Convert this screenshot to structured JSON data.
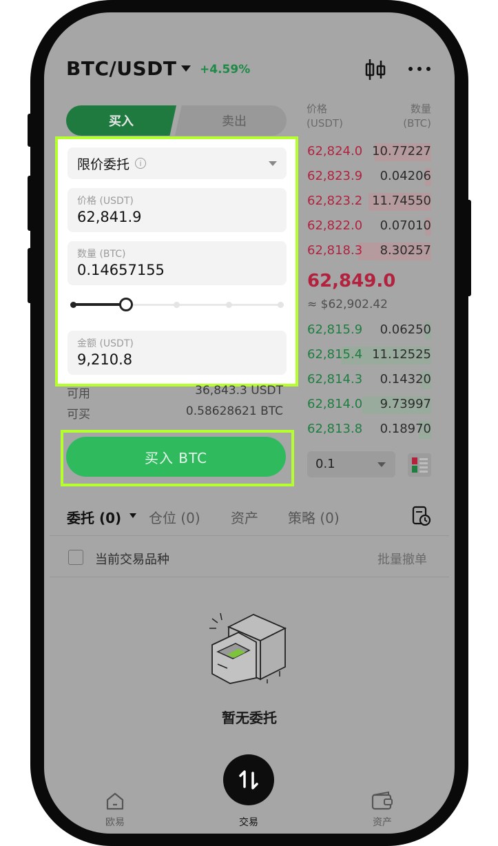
{
  "header": {
    "pair": "BTC/USDT",
    "change": "+4.59%"
  },
  "trade_tabs": {
    "buy": "买入",
    "sell": "卖出"
  },
  "form": {
    "order_type": "限价委托",
    "price_label": "价格 (USDT)",
    "price_value": "62,841.9",
    "qty_label": "数量 (BTC)",
    "qty_value": "0.14657155",
    "slider_percent": 25,
    "amount_label": "金额 (USDT)",
    "amount_value": "9,210.8"
  },
  "balances": {
    "available_label": "可用",
    "available_value": "36,843.3 USDT",
    "buyable_label": "可买",
    "buyable_value": "0.58628621 BTC"
  },
  "buy_button": "买入 BTC",
  "order_book": {
    "price_header_1": "价格",
    "price_header_2": "(USDT)",
    "qty_header_1": "数量",
    "qty_header_2": "(BTC)",
    "asks": [
      {
        "price": "62,824.0",
        "qty": "10.77227",
        "depth": 0.45
      },
      {
        "price": "62,823.9",
        "qty": "0.04206",
        "depth": 0.05
      },
      {
        "price": "62,823.2",
        "qty": "11.74550",
        "depth": 0.5
      },
      {
        "price": "62,822.0",
        "qty": "0.07010",
        "depth": 0.05
      },
      {
        "price": "62,818.3",
        "qty": "8.30257",
        "depth": 0.58
      }
    ],
    "last_price": "62,849.0",
    "fiat_price": "≈ $62,902.42",
    "bids": [
      {
        "price": "62,815.9",
        "qty": "0.06250",
        "depth": 0.05
      },
      {
        "price": "62,815.4",
        "qty": "11.12525",
        "depth": 0.72
      },
      {
        "price": "62,814.3",
        "qty": "0.14320",
        "depth": 0.08
      },
      {
        "price": "62,814.0",
        "qty": "9.73997",
        "depth": 0.55
      },
      {
        "price": "62,813.8",
        "qty": "0.18970",
        "depth": 0.1
      }
    ],
    "depth_step": "0.1"
  },
  "orders": {
    "tab_orders": "委托 (0)",
    "tab_positions": "仓位 (0)",
    "tab_assets": "资产",
    "tab_strategy": "策略 (0)",
    "current_pair_label": "当前交易品种",
    "cancel_all": "批量撤单",
    "empty_text": "暂无委托"
  },
  "nav": {
    "home": "欧易",
    "trade": "交易",
    "assets": "资产"
  },
  "colors": {
    "highlight": "#b5ff2e",
    "buy_green": "#2fba5d",
    "ask_red": "#b2223f",
    "bid_green": "#1e7e40"
  }
}
